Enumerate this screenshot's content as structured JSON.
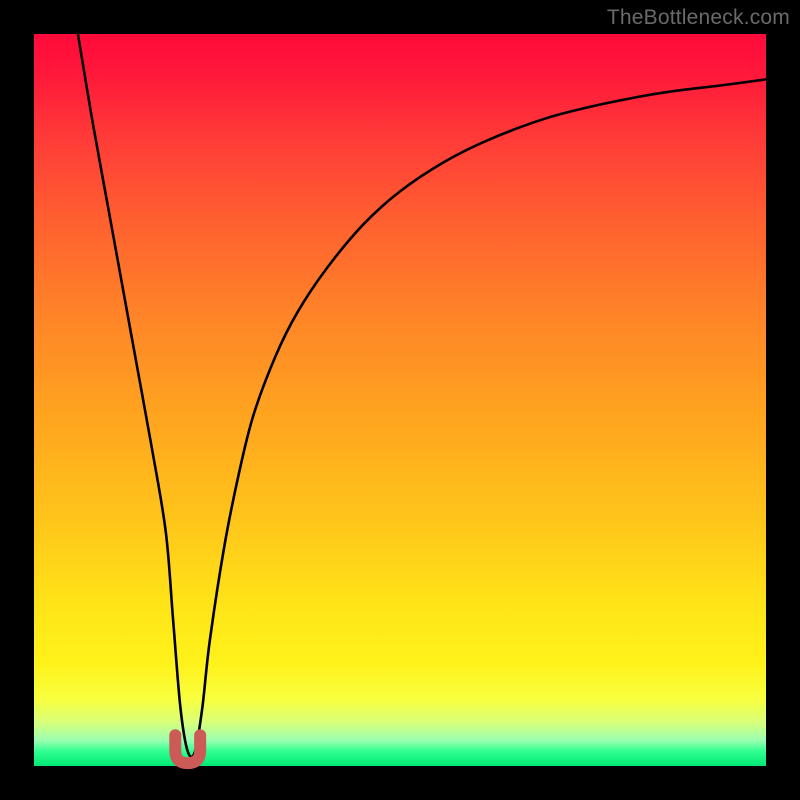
{
  "watermark": "TheBottleneck.com",
  "frame": {
    "outer_size_px": 800,
    "border_px": 34,
    "border_color": "#000000"
  },
  "gradient": {
    "top_color": "#ff0a3a",
    "mid_color": "#ffe418",
    "bottom_color": "#00e874"
  },
  "chart_data": {
    "type": "line",
    "title": "",
    "xlabel": "",
    "ylabel": "",
    "xlim": [
      0,
      100
    ],
    "ylim": [
      0,
      100
    ],
    "grid": false,
    "legend": false,
    "series": [
      {
        "name": "bottleneck-curve",
        "x": [
          6,
          8,
          10,
          12,
          14,
          16,
          18,
          19,
          20,
          21,
          22,
          23,
          24,
          26,
          28,
          30,
          33,
          36,
          40,
          45,
          50,
          56,
          62,
          70,
          78,
          86,
          94,
          100
        ],
        "y": [
          100,
          88,
          77,
          66,
          55,
          44,
          32,
          20,
          8,
          2,
          2,
          8,
          17,
          30,
          40,
          48,
          56,
          62,
          68,
          74,
          78.5,
          82.5,
          85.5,
          88.5,
          90.5,
          92,
          93,
          93.8
        ]
      }
    ],
    "marker": {
      "name": "optimal-marker",
      "shape": "u",
      "color": "#cc5a56",
      "x_center": 21,
      "x_width": 3.4,
      "y_bottom": 0.4,
      "y_top": 4.2
    }
  }
}
